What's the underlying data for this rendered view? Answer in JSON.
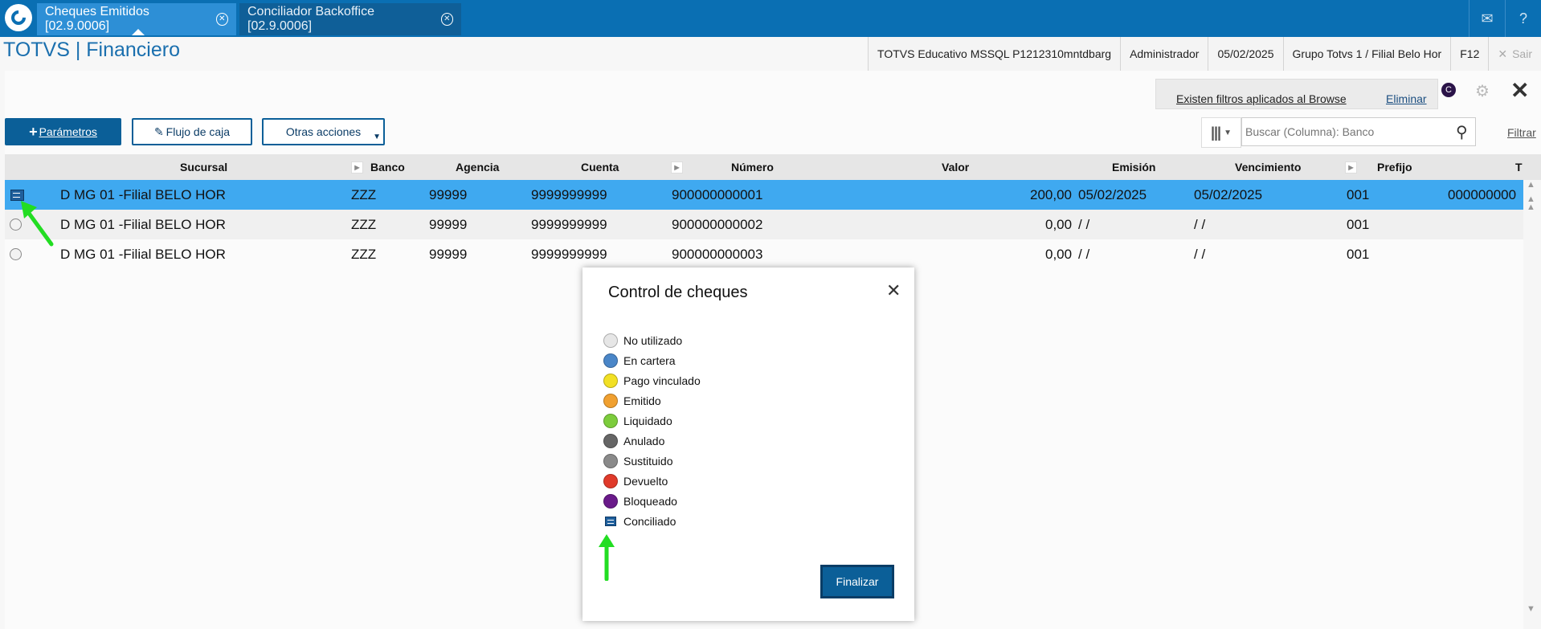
{
  "tabs": [
    {
      "label": "Cheques Emitidos [02.9.0006]",
      "active": true
    },
    {
      "label": "Conciliador Backoffice [02.9.0006]",
      "active": false
    }
  ],
  "top_icons": [
    "mail-icon",
    "help-icon"
  ],
  "app_title": "TOTVS | Financiero",
  "header": {
    "environment": "TOTVS Educativo MSSQL P1212310mntdbarg",
    "user": "Administrador",
    "date": "05/02/2025",
    "branch": "Grupo Totvs 1 / Filial Belo Hor",
    "shortcut": "F12",
    "exit_label": "Sair"
  },
  "filters": {
    "notice": "Existen filtros aplicados al Browse",
    "remove_label": "Eliminar"
  },
  "toolbar": {
    "parametros_label": "Parámetros",
    "flujo_label": "Flujo de caja",
    "otras_label": "Otras acciones",
    "search_placeholder": "Buscar (Columna): Banco",
    "filtrar_label": "Filtrar"
  },
  "grid": {
    "columns": [
      "Sucursal",
      "Banco",
      "Agencia",
      "Cuenta",
      "Número",
      "Valor",
      "Emisión",
      "Vencimiento",
      "Prefijo",
      "T"
    ],
    "rows": [
      {
        "status": "Conciliado",
        "sucursal": "D MG 01 -Filial BELO HOR",
        "banco": "ZZZ",
        "agencia": "99999",
        "cuenta": "9999999999",
        "numero": "900000000001",
        "valor": "200,00",
        "emision": "05/02/2025",
        "vencimiento": "05/02/2025",
        "prefijo": "001",
        "extra": "000000000"
      },
      {
        "status": "No utilizado",
        "sucursal": "D MG 01 -Filial BELO HOR",
        "banco": "ZZZ",
        "agencia": "99999",
        "cuenta": "9999999999",
        "numero": "900000000002",
        "valor": "0,00",
        "emision": "/ /",
        "vencimiento": "/ /",
        "prefijo": "001",
        "extra": ""
      },
      {
        "status": "No utilizado",
        "sucursal": "D MG 01 -Filial BELO HOR",
        "banco": "ZZZ",
        "agencia": "99999",
        "cuenta": "9999999999",
        "numero": "900000000003",
        "valor": "0,00",
        "emision": "/ /",
        "vencimiento": "/ /",
        "prefijo": "001",
        "extra": ""
      }
    ]
  },
  "modal": {
    "title": "Control de cheques",
    "legend": [
      {
        "label": "No utilizado",
        "color": "#e6e6e6"
      },
      {
        "label": "En cartera",
        "color": "#4a86c8"
      },
      {
        "label": "Pago vinculado",
        "color": "#f2e024"
      },
      {
        "label": "Emitido",
        "color": "#f0a030"
      },
      {
        "label": "Liquidado",
        "color": "#7ccc3c"
      },
      {
        "label": "Anulado",
        "color": "#666666"
      },
      {
        "label": "Sustituido",
        "color": "#8a8a8a"
      },
      {
        "label": "Devuelto",
        "color": "#e03a2a"
      },
      {
        "label": "Bloqueado",
        "color": "#6a1a8a"
      },
      {
        "label": "Conciliado",
        "color": "#1f5f9c"
      }
    ],
    "finalizar_label": "Finalizar"
  }
}
